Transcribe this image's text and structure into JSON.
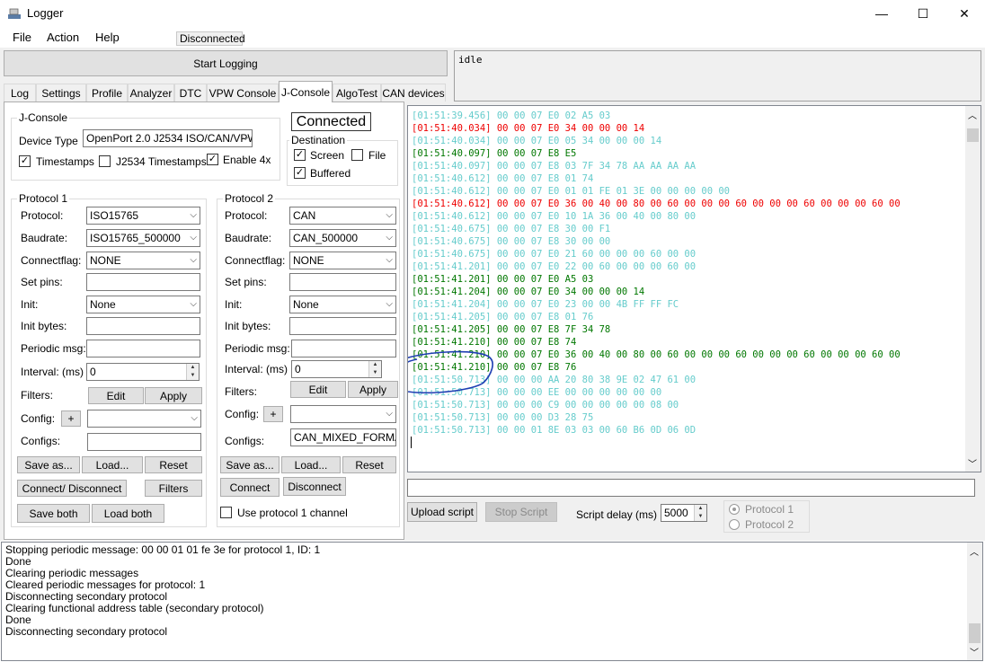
{
  "window": {
    "title": "Logger",
    "minimize": "—",
    "maximize": "☐",
    "close": "✕"
  },
  "menu": {
    "file": "File",
    "action": "Action",
    "help": "Help"
  },
  "connection_status": "Disconnected",
  "start_logging": "Start Logging",
  "status_text": "idle",
  "tabs": [
    "Log",
    "Settings",
    "Profile",
    "Analyzer",
    "DTC",
    "VPW Console",
    "J-Console",
    "AlgoTest",
    "CAN devices"
  ],
  "jconsole": {
    "group_title": "J-Console",
    "device_type_label": "Device Type",
    "device_type_value": "OpenPort 2.0 J2534 ISO/CAN/VPW",
    "timestamps": "Timestamps",
    "j2534_timestamps": "J2534 Timestamps",
    "enable4x": "Enable 4x",
    "connected_label": "Connected",
    "destination_title": "Destination",
    "screen": "Screen",
    "file": "File",
    "buffered": "Buffered"
  },
  "labels": {
    "protocol": "Protocol:",
    "baudrate": "Baudrate:",
    "connectflag": "Connectflag:",
    "set_pins": "Set pins:",
    "init": "Init:",
    "init_bytes": "Init bytes:",
    "periodic_msg": "Periodic msg:",
    "interval": "Interval: (ms)",
    "filters": "Filters:",
    "config": "Config:",
    "configs": "Configs:"
  },
  "protocol1": {
    "title": "Protocol 1",
    "protocol": "ISO15765",
    "baudrate": "ISO15765_500000",
    "connectflag": "NONE",
    "init": "None",
    "interval": "0",
    "edit": "Edit",
    "apply": "Apply",
    "plus": "+",
    "save_as": "Save as...",
    "load": "Load...",
    "reset": "Reset",
    "connect_disconnect": "Connect/ Disconnect",
    "filters_btn": "Filters",
    "save_both": "Save both",
    "load_both": "Load both"
  },
  "protocol2": {
    "title": "Protocol 2",
    "protocol": "CAN",
    "baudrate": "CAN_500000",
    "connectflag": "NONE",
    "init": "None",
    "interval": "0",
    "configs": "CAN_MIXED_FORMAT",
    "edit": "Edit",
    "apply": "Apply",
    "plus": "+",
    "save_as": "Save as...",
    "load": "Load...",
    "reset": "Reset",
    "connect": "Connect",
    "disconnect": "Disconnect",
    "use_protocol1": "Use protocol 1 channel"
  },
  "console_lines": [
    {
      "t": "[01:51:39.456] 00 00 07 E0 02 A5 03",
      "c": "cyan"
    },
    {
      "t": "[01:51:40.034] 00 00 07 E0 34 00 00 00 14",
      "c": "red"
    },
    {
      "t": "[01:51:40.034] 00 00 07 E0 05 34 00 00 00 14",
      "c": "cyan"
    },
    {
      "t": "[01:51:40.097] 00 00 07 E8 E5",
      "c": "green"
    },
    {
      "t": "[01:51:40.097] 00 00 07 E8 03 7F 34 78 AA AA AA AA",
      "c": "cyan"
    },
    {
      "t": "[01:51:40.612] 00 00 07 E8 01 74",
      "c": "cyan"
    },
    {
      "t": "[01:51:40.612] 00 00 07 E0 01 01 FE 01 3E 00 00 00 00 00",
      "c": "cyan"
    },
    {
      "t": "[01:51:40.612] 00 00 07 E0 36 00 40 00 80 00 60 00 00 00 60 00 00 00 60 00 00 00 60 00",
      "c": "red"
    },
    {
      "t": "[01:51:40.612] 00 00 07 E0 10 1A 36 00 40 00 80 00",
      "c": "cyan"
    },
    {
      "t": "[01:51:40.675] 00 00 07 E8 30 00 F1",
      "c": "cyan"
    },
    {
      "t": "[01:51:40.675] 00 00 07 E8 30 00 00",
      "c": "cyan"
    },
    {
      "t": "[01:51:40.675] 00 00 07 E0 21 60 00 00 00 60 00 00",
      "c": "cyan"
    },
    {
      "t": "[01:51:41.201] 00 00 07 E0 22 00 60 00 00 00 60 00",
      "c": "cyan"
    },
    {
      "t": "[01:51:41.201] 00 00 07 E0 A5 03",
      "c": "green"
    },
    {
      "t": "[01:51:41.204] 00 00 07 E0 34 00 00 00 14",
      "c": "green"
    },
    {
      "t": "[01:51:41.204] 00 00 07 E0 23 00 00 4B FF FF FC",
      "c": "cyan"
    },
    {
      "t": "[01:51:41.205] 00 00 07 E8 01 76",
      "c": "cyan"
    },
    {
      "t": "[01:51:41.205] 00 00 07 E8 7F 34 78",
      "c": "green"
    },
    {
      "t": "[01:51:41.210] 00 00 07 E8 74",
      "c": "green"
    },
    {
      "t": "[01:51:41.210] 00 00 07 E0 36 00 40 00 80 00 60 00 00 00 60 00 00 00 60 00 00 00 60 00",
      "c": "green"
    },
    {
      "t": "[01:51:41.210] 00 00 07 E8 76",
      "c": "green"
    },
    {
      "t": "[01:51:50.713] 00 00 00 AA 20 80 38 9E 02 47 61 00",
      "c": "cyan"
    },
    {
      "t": "[01:51:50.713] 00 00 00 EE 00 00 00 00 00 00",
      "c": "cyan"
    },
    {
      "t": "[01:51:50.713] 00 00 00 C9 00 00 00 00 00 08 00",
      "c": "cyan"
    },
    {
      "t": "[01:51:50.713] 00 00 00 D3 28 75",
      "c": "cyan"
    },
    {
      "t": "[01:51:50.713] 00 00 01 8E 03 03 00 60 B6 0D 06 0D",
      "c": "cyan"
    }
  ],
  "console_colors": {
    "cyan": "#66cccc",
    "red": "#ee0000",
    "green": "#007700"
  },
  "script": {
    "upload": "Upload script",
    "stop": "Stop Script",
    "delay_label": "Script delay (ms)",
    "delay_value": "5000",
    "protocol1": "Protocol 1",
    "protocol2": "Protocol 2"
  },
  "log_lines": [
    "Stopping periodic message: 00 00 01 01 fe 3e for protocol 1, ID: 1",
    "Done",
    "Clearing periodic messages",
    "Cleared periodic messages for protocol: 1",
    "Disconnecting secondary protocol",
    "Clearing functional address table (secondary protocol)",
    "Done",
    "Disconnecting secondary protocol"
  ]
}
